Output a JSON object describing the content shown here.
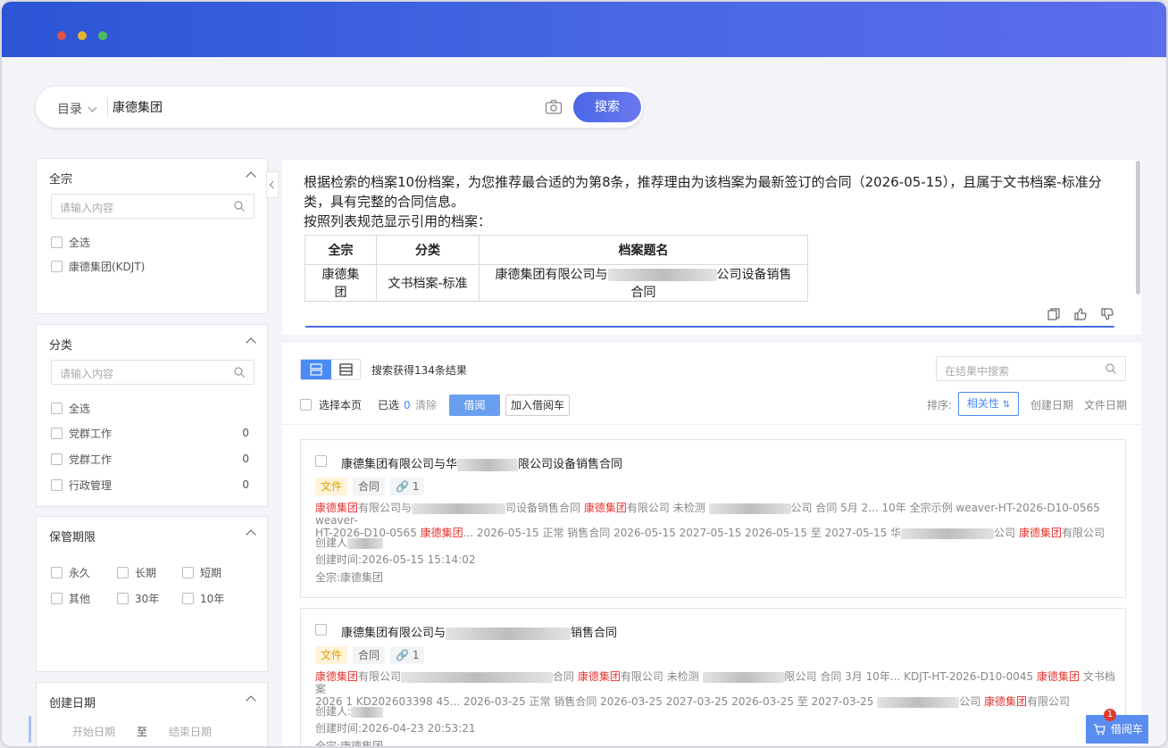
{
  "search": {
    "scope_label": "目录",
    "query": "康德集团",
    "button_label": "搜索"
  },
  "filters": {
    "quanzong": {
      "title": "全宗",
      "placeholder": "请输入内容",
      "options": [
        "全选",
        "康德集团(KDJT)"
      ]
    },
    "fenlei": {
      "title": "分类",
      "placeholder": "请输入内容",
      "options": [
        {
          "label": "全选",
          "count": ""
        },
        {
          "label": "党群工作",
          "count": "0"
        },
        {
          "label": "党群工作",
          "count": "0"
        },
        {
          "label": "行政管理",
          "count": "0"
        }
      ]
    },
    "baoguan": {
      "title": "保管期限",
      "options": [
        "永久",
        "长期",
        "短期",
        "其他",
        "30年",
        "10年"
      ]
    },
    "date": {
      "title": "创建日期",
      "start": "开始日期",
      "to": "至",
      "end": "结束日期"
    }
  },
  "ai_answer": {
    "line1": "根据检索的档案10份档案，为您推荐最合适的为第8条，推荐理由为该档案为最新签订的合同（2026-05-15），且属于文书档案-标准分类，具有完整的合同信息。",
    "line2": "按照列表规范显示引用的档案：",
    "table": {
      "headers": [
        "全宗",
        "分类",
        "档案题名"
      ],
      "row": {
        "quanzong": "康德集团",
        "fenlei": "文书档案-标准",
        "title_prefix": "康德集团有限公司与",
        "title_suffix": "公司设备销售合同"
      }
    }
  },
  "results": {
    "count_text": "搜索获得134条结果",
    "inner_search_placeholder": "在结果中搜索",
    "select_page": "选择本页",
    "selected_label": "已选",
    "selected_count": "0",
    "clear": "清除",
    "borrow": "借阅",
    "add_cart": "加入借阅车",
    "sort_label": "排序:",
    "sort_relevance": "相关性",
    "sort_create": "创建日期",
    "sort_file": "文件日期",
    "items": [
      {
        "title_prefix": "康德集团有限公司与华",
        "title_suffix": "限公司设备销售合同",
        "tag_file": "文件",
        "tag_type": "合同",
        "tag_link": "1",
        "s1a": "康德集团",
        "s1b": "有限公司与",
        "s1c": "司设备销售合同 ",
        "s1d": "康德集团",
        "s1e": "有限公司 未检测 ",
        "s1f": "公司 合同 5月 2... 10年 全宗示例 weaver-HT-2026-D10-0565 weaver-",
        "s2a": "HT-2026-D10-0565 ",
        "s2b": "康德集团",
        "s2c": "... 2026-05-15 正常 销售合同 2026-05-15 2027-05-15 2026-05-15 至 2027-05-15 华",
        "s2d": "公司 ",
        "s2e": "康德集团",
        "s2f": "有限公司",
        "creator": "创建人",
        "created": "创建时间:2026-05-15 15:14:02",
        "fonds": "全宗:康德集团"
      },
      {
        "title_prefix": "康德集团有限公司与",
        "title_suffix": "销售合同",
        "tag_file": "文件",
        "tag_type": "合同",
        "tag_link": "1",
        "s1a": "康德集团",
        "s1b": "有限公司",
        "s1c": "合同 ",
        "s1d": "康德集团",
        "s1e": "有限公司 未检测 ",
        "s1f": "限公司 合同 3月 10年... KDJT-HT-2026-D10-0045 ",
        "s1g": "康德集团",
        "s1h": " 文书档案",
        "s2a": "2026 1 KD202603398 45... 2026-03-25 正常 销售合同 2026-03-25 2027-03-25 2026-03-25 至 2027-03-25 ",
        "s2d": "公司 ",
        "s2e": "康德集团",
        "s2f": "有限公司",
        "creator": "创建人:",
        "created": "创建时间:2026-04-23 20:53:21",
        "fonds": "全宗:康德集团"
      }
    ]
  },
  "borrow_cart": {
    "label": "借阅车",
    "badge": "1"
  }
}
